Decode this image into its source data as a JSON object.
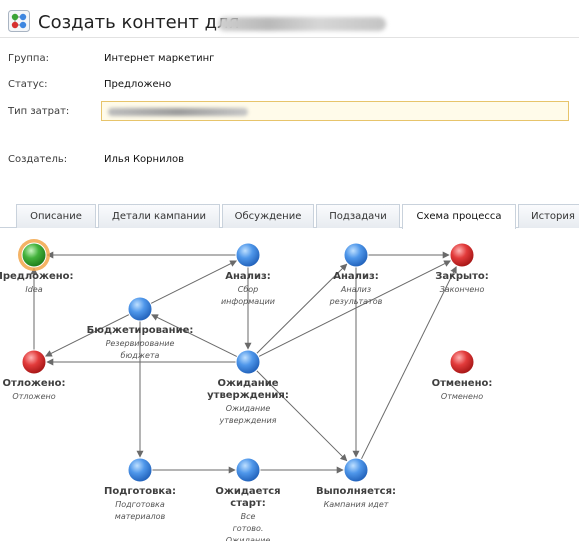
{
  "header": {
    "title": "Создать контент для"
  },
  "fields": [
    {
      "label": "Группа:",
      "value": "Интернет маркетинг"
    },
    {
      "label": "Статус:",
      "value": "Предложено"
    },
    {
      "label": "Тип затрат:",
      "value": ""
    },
    {
      "label": "Создатель:",
      "value": "Илья Корнилов"
    }
  ],
  "tabs": [
    {
      "label": "Описание",
      "active": false
    },
    {
      "label": "Детали кампании",
      "active": false
    },
    {
      "label": "Обсуждение",
      "active": false
    },
    {
      "label": "Подзадачи",
      "active": false
    },
    {
      "label": "Схема процесса",
      "active": true
    },
    {
      "label": "История",
      "active": false
    }
  ],
  "diagram": {
    "colors": {
      "current": "#3aa336",
      "state": "#3d86e0",
      "terminal": "#d62f2f",
      "edge": "#6a6a6a",
      "highlight": "#f2a64a"
    },
    "nodes": [
      {
        "id": "proposed",
        "color": "green",
        "current": true,
        "title_lines": [
          "Предложено:"
        ],
        "sub_lines": [
          "Idea"
        ]
      },
      {
        "id": "analysis1",
        "color": "blue",
        "current": false,
        "title_lines": [
          "Анализ:"
        ],
        "sub_lines": [
          "Сбор",
          "информации"
        ]
      },
      {
        "id": "analysis2",
        "color": "blue",
        "current": false,
        "title_lines": [
          "Анализ:"
        ],
        "sub_lines": [
          "Анализ",
          "результатов"
        ]
      },
      {
        "id": "closed",
        "color": "red",
        "current": false,
        "title_lines": [
          "Закрыто:"
        ],
        "sub_lines": [
          "Закончено"
        ]
      },
      {
        "id": "budgeting",
        "color": "blue",
        "current": false,
        "title_lines": [
          "Бюджетирование:"
        ],
        "sub_lines": [
          "Резервирование",
          "бюджета"
        ]
      },
      {
        "id": "postponed",
        "color": "red",
        "current": false,
        "title_lines": [
          "Отложено:"
        ],
        "sub_lines": [
          "Отложено"
        ]
      },
      {
        "id": "awaiting",
        "color": "blue",
        "current": false,
        "title_lines": [
          "Ожидание",
          "утверждения:"
        ],
        "sub_lines": [
          "Ожидание",
          "утверждения"
        ]
      },
      {
        "id": "cancelled",
        "color": "red",
        "current": false,
        "title_lines": [
          "Отменено:"
        ],
        "sub_lines": [
          "Отменено"
        ]
      },
      {
        "id": "preparation",
        "color": "blue",
        "current": false,
        "title_lines": [
          "Подготовка:"
        ],
        "sub_lines": [
          "Подготовка",
          "материалов"
        ]
      },
      {
        "id": "waitstart",
        "color": "blue",
        "current": false,
        "title_lines": [
          "Ожидается",
          "старт:"
        ],
        "sub_lines": [
          "Все",
          "готово.",
          "Ожидание"
        ]
      },
      {
        "id": "running",
        "color": "blue",
        "current": false,
        "title_lines": [
          "Выполняется:"
        ],
        "sub_lines": [
          "Кампания идет"
        ]
      }
    ],
    "edges": [
      {
        "from": "analysis1",
        "to": "proposed"
      },
      {
        "from": "budgeting",
        "to": "analysis1"
      },
      {
        "from": "budgeting",
        "to": "postponed"
      },
      {
        "from": "postponed",
        "to": "proposed"
      },
      {
        "from": "analysis1",
        "to": "awaiting"
      },
      {
        "from": "awaiting",
        "to": "budgeting"
      },
      {
        "from": "awaiting",
        "to": "analysis2"
      },
      {
        "from": "analysis2",
        "to": "closed"
      },
      {
        "from": "awaiting",
        "to": "closed"
      },
      {
        "from": "awaiting",
        "to": "postponed"
      },
      {
        "from": "budgeting",
        "to": "preparation"
      },
      {
        "from": "preparation",
        "to": "waitstart"
      },
      {
        "from": "waitstart",
        "to": "running"
      },
      {
        "from": "awaiting",
        "to": "running"
      },
      {
        "from": "analysis2",
        "to": "running"
      },
      {
        "from": "running",
        "to": "closed"
      }
    ]
  }
}
